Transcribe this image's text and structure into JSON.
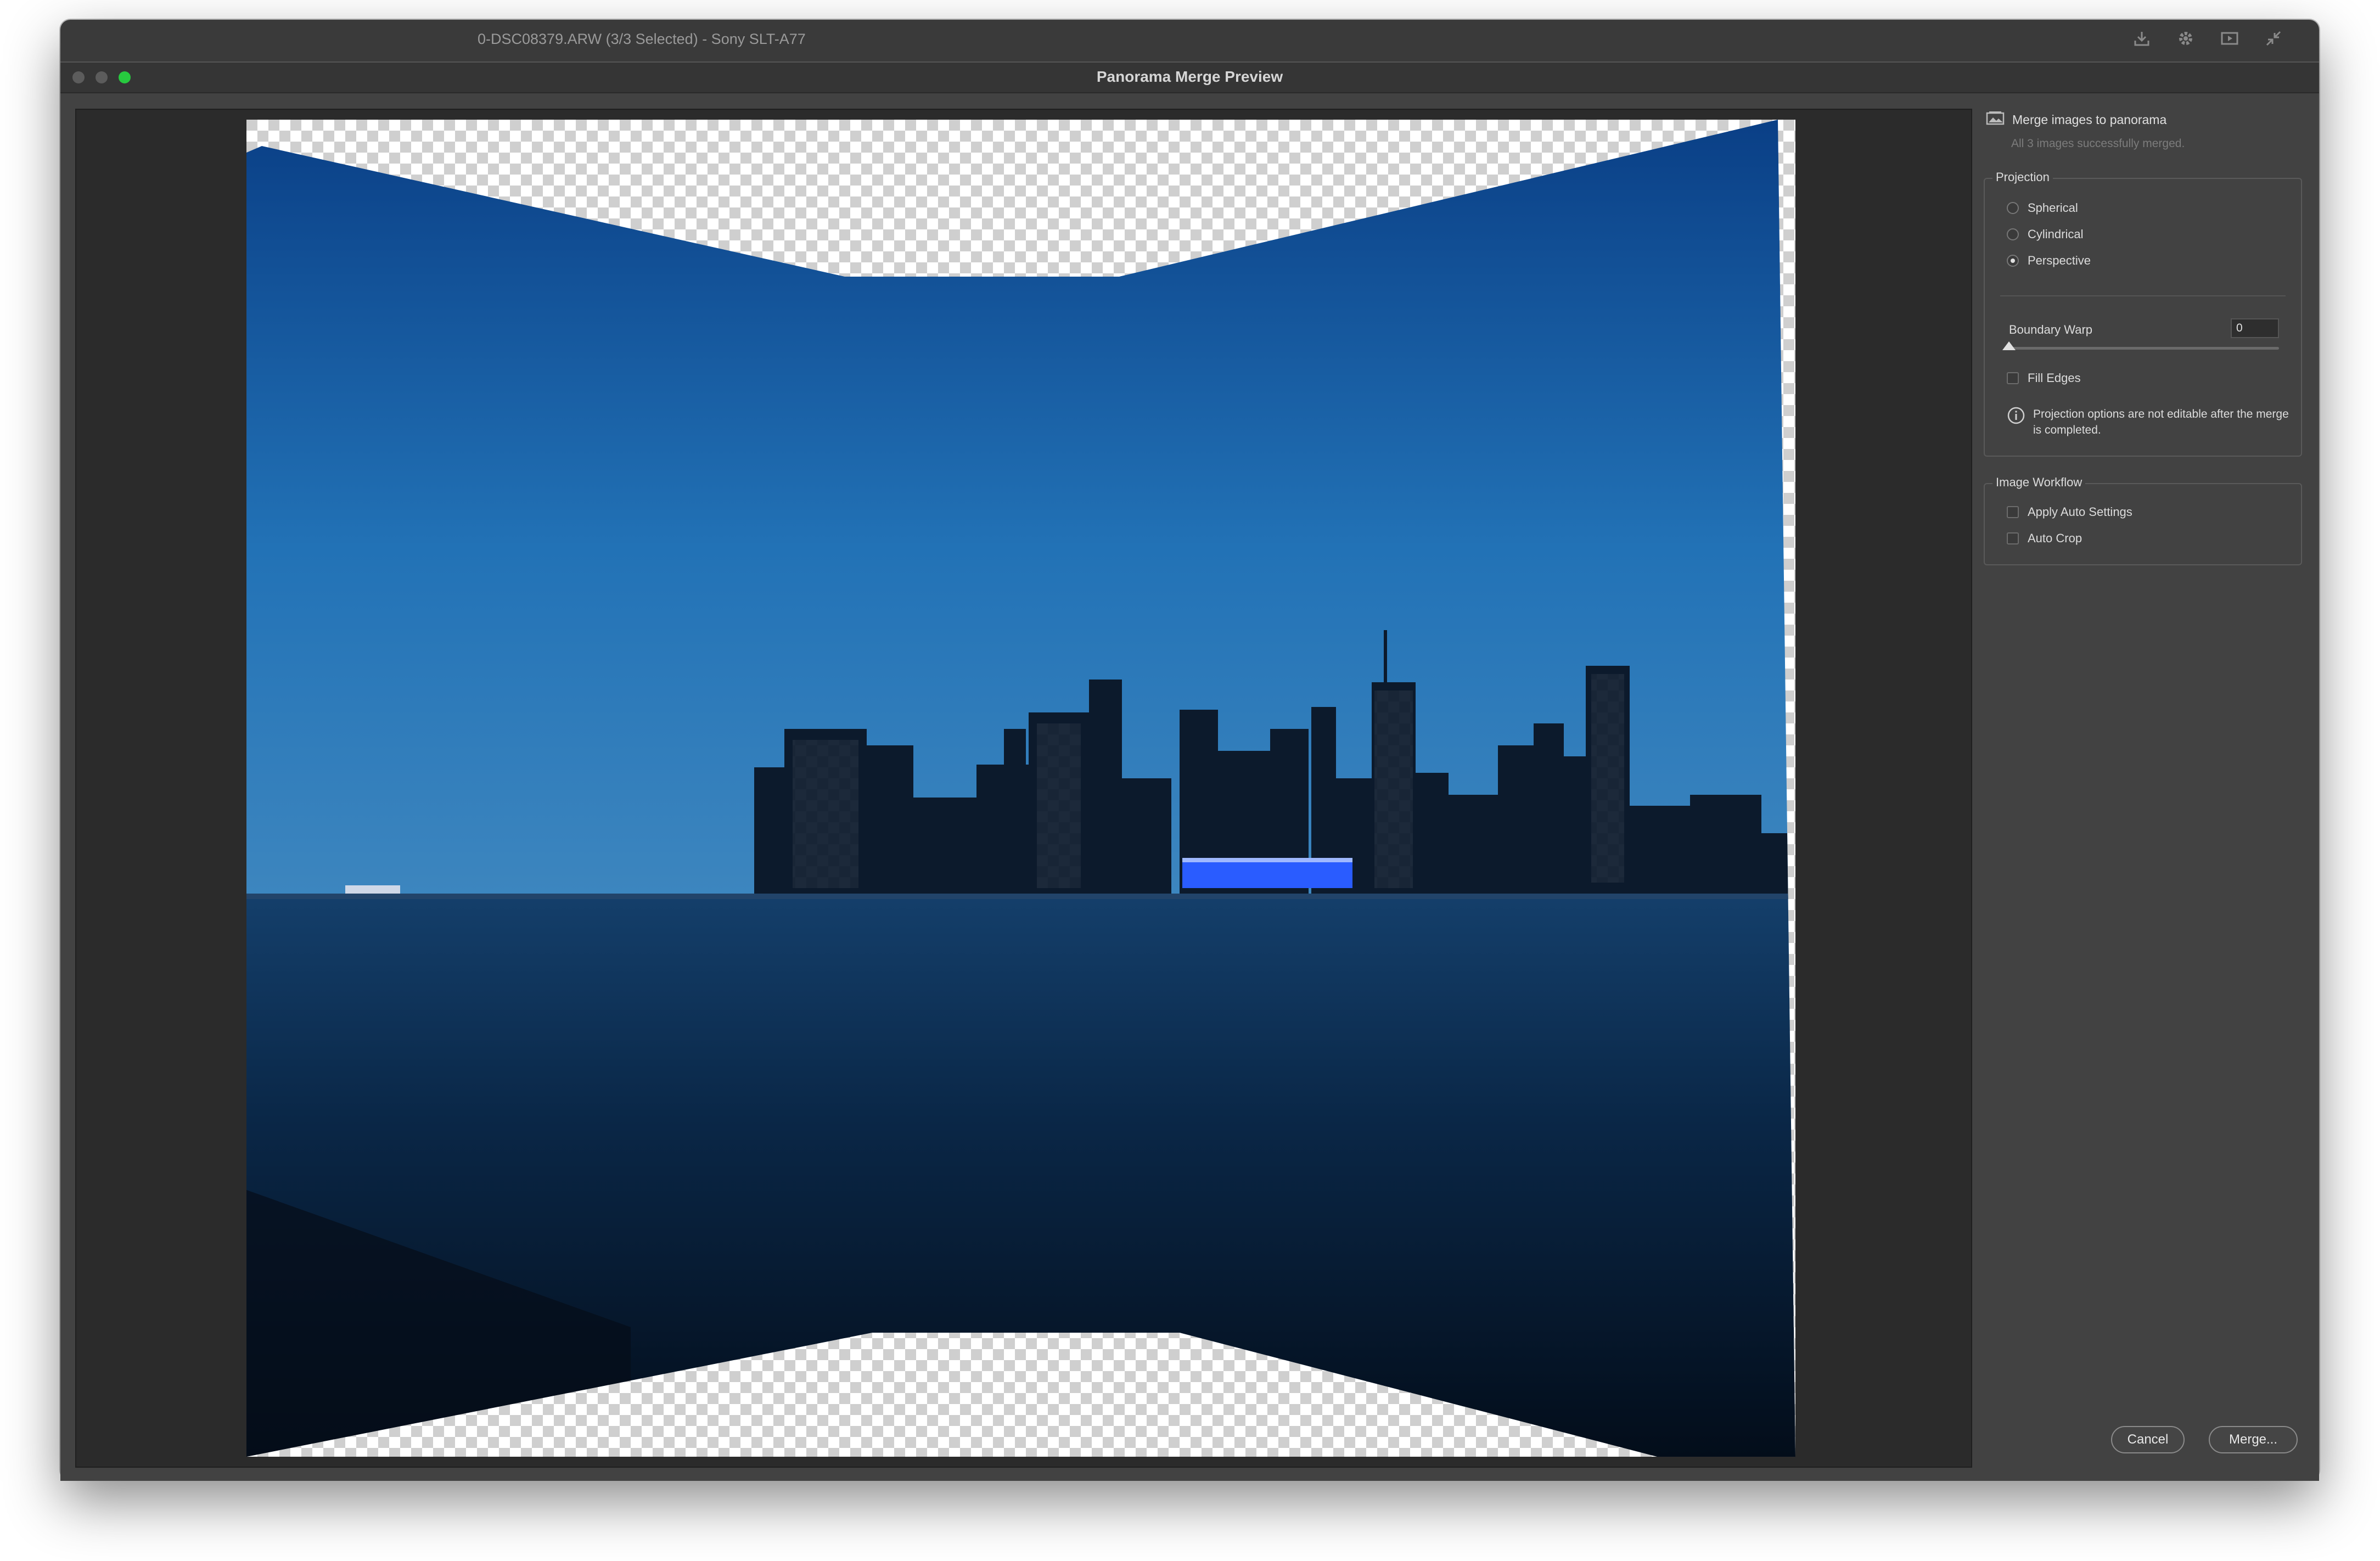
{
  "background_window": {
    "title": "0-DSC08379.ARW (3/3 Selected)  -  Sony SLT-A77",
    "icons": [
      "download-icon",
      "gear-icon",
      "slideshow-icon",
      "collapse-icon"
    ]
  },
  "dialog": {
    "title": "Panorama Merge Preview",
    "window_controls": [
      "close",
      "minimize",
      "zoom"
    ]
  },
  "panel": {
    "header_title": "Merge images to panorama",
    "header_status": "All 3 images successfully merged.",
    "projection": {
      "legend": "Projection",
      "options": [
        {
          "label": "Spherical",
          "selected": false
        },
        {
          "label": "Cylindrical",
          "selected": false
        },
        {
          "label": "Perspective",
          "selected": true
        }
      ],
      "boundary_warp_label": "Boundary Warp",
      "boundary_warp_value": "0",
      "boundary_warp_level": 0,
      "fill_edges_label": "Fill Edges",
      "fill_edges_checked": false,
      "info_text": "Projection options are not editable after the merge is completed."
    },
    "workflow": {
      "legend": "Image Workflow",
      "options": [
        {
          "label": "Apply Auto Settings",
          "checked": false
        },
        {
          "label": "Auto Crop",
          "checked": false
        }
      ]
    }
  },
  "buttons": {
    "cancel": "Cancel",
    "merge": "Merge..."
  },
  "colors": {
    "sky_top": "#0a3f86",
    "sky_mid": "#1f6fb5",
    "water": "#07203f",
    "close": "#5c5c5c",
    "zoom": "#27c93f"
  }
}
